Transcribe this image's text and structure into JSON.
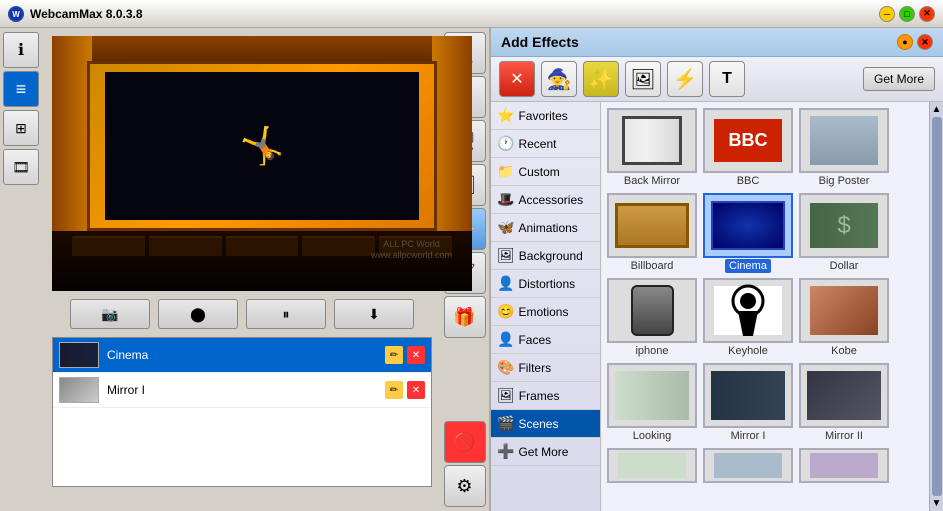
{
  "app": {
    "title": "WebcamMax  8.0.3.8",
    "logo_text": "W"
  },
  "titlebar": {
    "min_label": "─",
    "max_label": "□",
    "close_label": "✕"
  },
  "titlebar_right": {
    "btn1": "●",
    "btn2": "●"
  },
  "controls": {
    "snapshot": "📷",
    "record": "●",
    "pause": "⏸",
    "download": "⬇"
  },
  "effects_header": "Add Effects",
  "effects_toolbar": {
    "remove_btn": "✕",
    "magic_btn": "🧙",
    "effects_btn": "✨",
    "add_image_btn": "🖼",
    "add_flash_btn": "⚡",
    "add_text_btn": "T",
    "get_more": "Get More"
  },
  "categories": [
    {
      "id": "favorites",
      "label": "Favorites",
      "icon": "⭐"
    },
    {
      "id": "recent",
      "label": "Recent",
      "icon": "🕐"
    },
    {
      "id": "custom",
      "label": "Custom",
      "icon": "📁"
    },
    {
      "id": "accessories",
      "label": "Accessories",
      "icon": "🎩"
    },
    {
      "id": "animations",
      "label": "Animations",
      "icon": "🦋"
    },
    {
      "id": "background",
      "label": "Background",
      "icon": "🖼"
    },
    {
      "id": "distortions",
      "label": "Distortions",
      "icon": "👤"
    },
    {
      "id": "emotions",
      "label": "Emotions",
      "icon": "😊"
    },
    {
      "id": "faces",
      "label": "Faces",
      "icon": "👤"
    },
    {
      "id": "filters",
      "label": "Filters",
      "icon": "🎨"
    },
    {
      "id": "frames",
      "label": "Frames",
      "icon": "🖼"
    },
    {
      "id": "scenes",
      "label": "Scenes",
      "icon": "🎬"
    },
    {
      "id": "get_more",
      "label": "Get More",
      "icon": "➕"
    }
  ],
  "effects_grid": [
    {
      "id": "back_mirror",
      "label": "Back Mirror",
      "selected": false
    },
    {
      "id": "bbc",
      "label": "BBC",
      "selected": false
    },
    {
      "id": "big_poster",
      "label": "Big Poster",
      "selected": false
    },
    {
      "id": "billboard",
      "label": "Billboard",
      "selected": false
    },
    {
      "id": "cinema",
      "label": "Cinema",
      "selected": true
    },
    {
      "id": "dollar",
      "label": "Dollar",
      "selected": false
    },
    {
      "id": "iphone",
      "label": "iphone",
      "selected": false
    },
    {
      "id": "keyhole",
      "label": "Keyhole",
      "selected": false
    },
    {
      "id": "kobe",
      "label": "Kobe",
      "selected": false
    },
    {
      "id": "looking",
      "label": "Looking",
      "selected": false
    },
    {
      "id": "mirror_i",
      "label": "Mirror I",
      "selected": false
    },
    {
      "id": "mirror_ii",
      "label": "Mirror II",
      "selected": false
    }
  ],
  "applied_effects": [
    {
      "id": "cinema",
      "label": "Cinema",
      "type": "cinema"
    },
    {
      "id": "mirror_i",
      "label": "Mirror I",
      "type": "mirror"
    }
  ],
  "left_tabs": [
    {
      "id": "info",
      "icon": "ℹ",
      "active": false
    },
    {
      "id": "list",
      "icon": "≡",
      "active": true
    },
    {
      "id": "grid",
      "icon": "⊞",
      "active": false
    },
    {
      "id": "film",
      "icon": "🎞",
      "active": false
    }
  ],
  "toolbar_items": [
    {
      "id": "person",
      "icon": "👤"
    },
    {
      "id": "video",
      "icon": "🎬"
    },
    {
      "id": "screen",
      "icon": "🖥"
    },
    {
      "id": "image",
      "icon": "🖼"
    },
    {
      "id": "effects",
      "icon": "✨",
      "active": true
    },
    {
      "id": "brush",
      "icon": "🖌"
    },
    {
      "id": "box",
      "icon": "📦"
    },
    {
      "id": "error",
      "icon": "🚫"
    },
    {
      "id": "settings",
      "icon": "⚙"
    }
  ],
  "watermark": "ALL PC World\nwww.allpcworld.com",
  "colors": {
    "selected_bg": "#0066cc",
    "selected_label_bg": "#2266dd",
    "accent": "#5599dd"
  }
}
